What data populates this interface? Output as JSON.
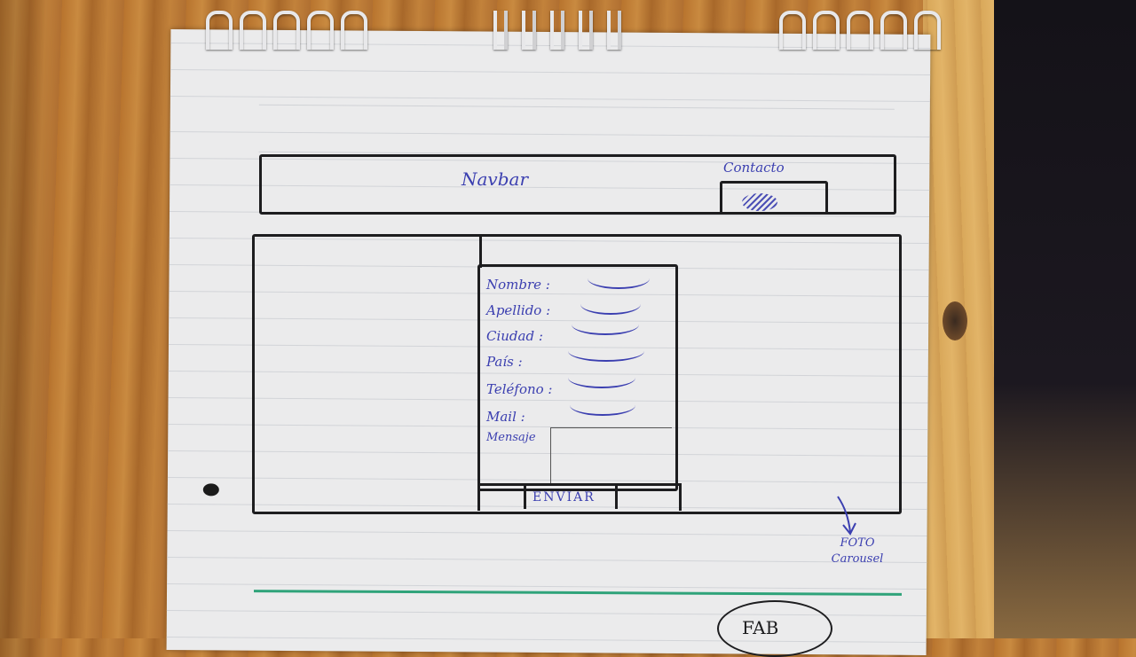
{
  "sketch": {
    "navbar_label": "Navbar",
    "contact_label": "Contacto",
    "form_fields": [
      {
        "label": "Nombre :"
      },
      {
        "label": "Apellido :"
      },
      {
        "label": "Ciudad :"
      },
      {
        "label": "País :"
      },
      {
        "label": "Teléfono :"
      },
      {
        "label": "Mail :"
      },
      {
        "label": "Mensaje"
      }
    ],
    "submit_label": "ENVIAR",
    "carousel_note": "FOTO Carousel",
    "footer_label": "FAB"
  },
  "colors": {
    "ink_blue": "#3b3fb0",
    "ink_black": "#1d1d1f",
    "highlighter_green": "#2fa37a",
    "paper": "#ebebec"
  }
}
